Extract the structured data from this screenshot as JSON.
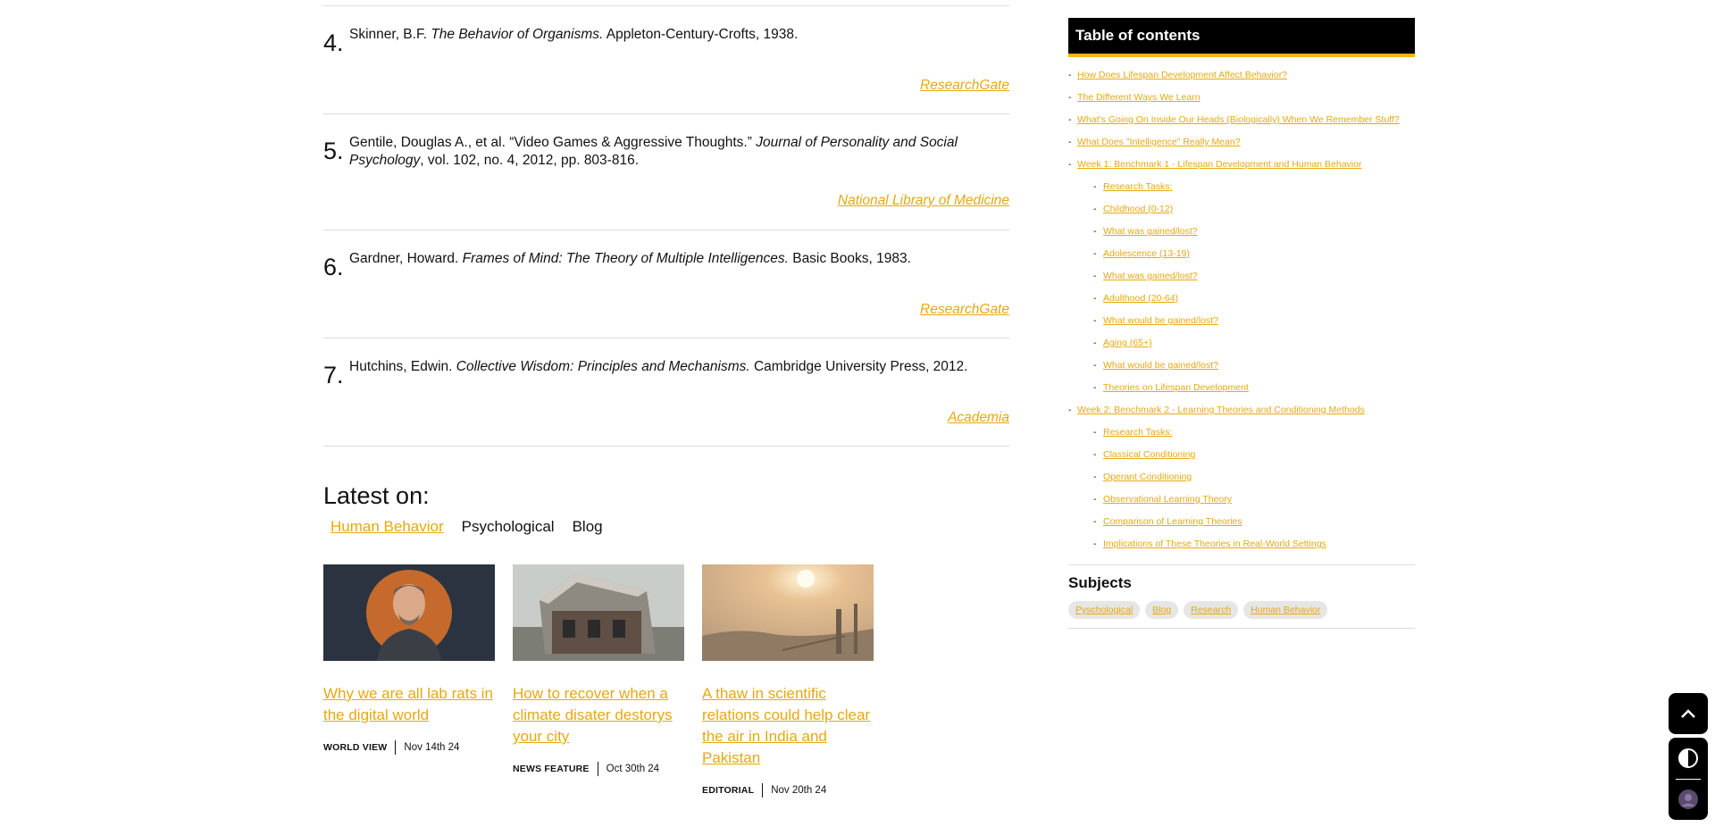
{
  "references": [
    {
      "num": "4.",
      "author": "Skinner, B.F. ",
      "title": "The Behavior of Organisms.",
      "rest": " Appleton-Century-Crofts, 1938.",
      "link": "ResearchGate"
    },
    {
      "num": "5.",
      "author": "Gentile, Douglas A., et al. “Video Games & Aggressive Thoughts.” ",
      "title": "Journal of Personality and Social Psychology",
      "rest": ", vol. 102, no. 4, 2012, pp. 803-816.",
      "link": "National Library of Medicine"
    },
    {
      "num": "6.",
      "author": "Gardner, Howard. ",
      "title": "Frames of Mind: The Theory of Multiple Intelligences.",
      "rest": " Basic Books, 1983.",
      "link": "ResearchGate"
    },
    {
      "num": "7.",
      "author": "Hutchins, Edwin. ",
      "title": "Collective Wisdom: Principles and Mechanisms.",
      "rest": " Cambridge University Press, 2012.",
      "link": "Academia"
    }
  ],
  "latest": {
    "title": "Latest on:",
    "tabs": [
      "Human Behavior",
      "Psychological",
      "Blog"
    ],
    "cards": [
      {
        "title": "Why we are all lab rats in the digital world",
        "category": "WORLD VIEW",
        "date": "Nov 14th 24"
      },
      {
        "title": "How to recover when a climate disater destorys your city",
        "category": "NEWS FEATURE",
        "date": "Oct 30th 24"
      },
      {
        "title": "A thaw in scientific relations could help clear the air in India and Pakistan",
        "category": "EDITORIAL",
        "date": "Nov 20th 24"
      }
    ]
  },
  "toc": {
    "title": "Table of contents",
    "dash": "-",
    "items": [
      {
        "label": "How Does Lifespan Development Affect Behavior?",
        "level": 1
      },
      {
        "label": "The Different Ways We Learn",
        "level": 1
      },
      {
        "label": "What’s Going On Inside Our Heads (Biologically) When We Remember Stuff?",
        "level": 1
      },
      {
        "label": "What Does \"Intelligence\" Really Mean?",
        "level": 1
      },
      {
        "label": "Week 1: Benchmark 1 - Lifespan Development and Human Behavior",
        "level": 1
      },
      {
        "label": "Research Tasks:",
        "level": 2
      },
      {
        "label": "Childhood (0-12)",
        "level": 2
      },
      {
        "label": "What was gained/lost?",
        "level": 2
      },
      {
        "label": "Adolescence (13-19)",
        "level": 2
      },
      {
        "label": "What was gained/lost?",
        "level": 2
      },
      {
        "label": "Adulthood (20-64)",
        "level": 2
      },
      {
        "label": "What would be gained/lost?",
        "level": 2
      },
      {
        "label": "Aging (65+)",
        "level": 2
      },
      {
        "label": "What would be gained/lost?",
        "level": 2
      },
      {
        "label": "Theories on Lifespan Development",
        "level": 2
      },
      {
        "label": "Week 2: Benchmark 2 - Learning Theories and Conditioning Methods",
        "level": 1
      },
      {
        "label": "Research Tasks:",
        "level": 2
      },
      {
        "label": "Classical Conditioning",
        "level": 2
      },
      {
        "label": "Operant Conditioning",
        "level": 2
      },
      {
        "label": "Observational Learning Theory",
        "level": 2
      },
      {
        "label": "Comparison of Learning Theories",
        "level": 2
      },
      {
        "label": "Implications of These Theories in Real-World Settings",
        "level": 2
      }
    ]
  },
  "subjects": {
    "title": "Subjects",
    "chips": [
      "Pyschological",
      "Blog",
      "Research",
      "Human Behavior"
    ]
  },
  "colors": {
    "accent": "#e7a810",
    "toc_header_bg": "#000000",
    "toc_underline": "#f5b514"
  },
  "icons": {
    "scroll_top": "chevron-up-icon",
    "theme": "contrast-icon",
    "avatar": "user-avatar"
  }
}
